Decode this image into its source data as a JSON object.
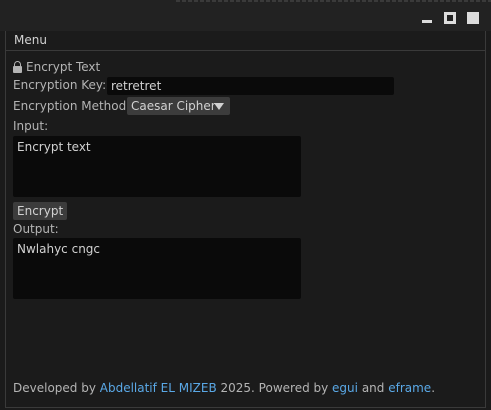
{
  "window": {
    "minimize_icon": "minimize-icon",
    "maximize_icon": "maximize-icon",
    "close_icon": "close-icon"
  },
  "menu": {
    "label": "Menu"
  },
  "heading": {
    "icon": "lock-icon",
    "text": "Encrypt Text"
  },
  "form": {
    "key_label": "Encryption Key:",
    "key_value": "retretret",
    "method_label": "Encryption Method",
    "method_selected": "Caesar Cipher",
    "input_label": "Input:",
    "input_value": "Encrypt text",
    "encrypt_button": "Encrypt",
    "output_label": "Output:",
    "output_value": "Nwlahyc cngc"
  },
  "footer": {
    "prefix": "Developed by ",
    "author": "Abdellatif EL MIZEB",
    "middle": " 2025. Powered by ",
    "lib1": "egui",
    "and": " and ",
    "lib2": "eframe",
    "suffix": "."
  },
  "colors": {
    "background": "#1b1b1b",
    "field_bg": "#0a0a0a",
    "button_bg": "#3c3c3c",
    "link": "#5aa8e6",
    "text": "#b4b4b4"
  }
}
